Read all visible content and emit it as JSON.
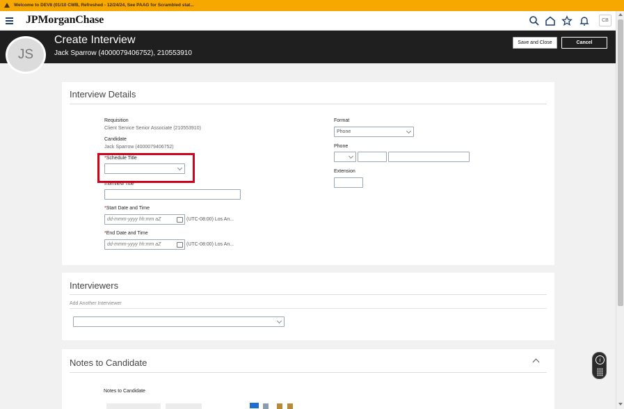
{
  "banner": {
    "text": "Welcome to DEV8 (01/10 CWB, Refreshed - 12/24/24, See PAAG for Scrambled stat..."
  },
  "topbar": {
    "logo": "JPMorganChase",
    "user_initials": "CB",
    "icons": [
      "hamburger-icon",
      "search-icon",
      "home-icon",
      "star-icon",
      "bell-icon"
    ]
  },
  "header": {
    "avatar_initials": "JS",
    "title": "Create Interview",
    "subtitle": "Jack Sparrow (4000079406752), 210553910",
    "save_label": "Save and Close",
    "cancel_label": "Cancel"
  },
  "details": {
    "title": "Interview Details",
    "requisition_label": "Requisition",
    "requisition_value": "Client Service Senior Associate (210553910)",
    "candidate_label": "Candidate",
    "candidate_value": "Jack Sparrow (4000079406752)",
    "schedule_title_label": "Schedule Title",
    "schedule_title_value": "",
    "interview_title_label": "Interview Title",
    "interview_title_value": "",
    "start_label": "Start Date and Time",
    "start_placeholder": "dd-mmm-yyyy hh:mm aZ",
    "start_tz": "(UTC-08:00) Los An...",
    "end_label": "End Date and Time",
    "end_placeholder": "dd-mmm-yyyy hh:mm aZ",
    "end_tz": "(UTC-08:00) Los An...",
    "required_mark": "*",
    "format_label": "Format",
    "format_value": "Phone",
    "phone_label": "Phone",
    "extension_label": "Extension"
  },
  "interviewers": {
    "title": "Interviewers",
    "add_label": "Add Another Interviewer"
  },
  "notes": {
    "title": "Notes to Candidate",
    "field_label": "Notes to Candidate"
  },
  "colors": {
    "banner": "#f7a800",
    "header": "#1f1f1f",
    "highlight": "#d0021b",
    "brand": "#1a3c6e"
  }
}
